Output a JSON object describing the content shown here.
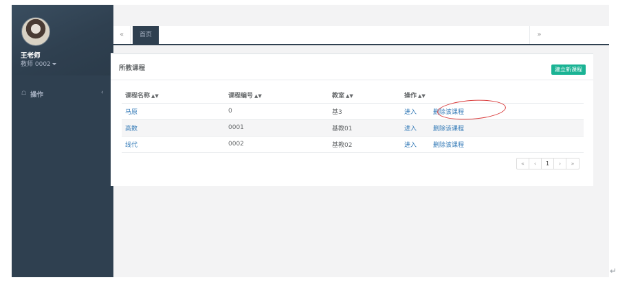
{
  "sidebar": {
    "user_name": "王老师",
    "user_role": "教师 0002",
    "nav_items": [
      {
        "icon": "home-icon",
        "label": "操作",
        "arrow": "‹"
      }
    ]
  },
  "tabs": {
    "prev": "«",
    "active": "首页",
    "next": "»"
  },
  "panel": {
    "title": "所教课程",
    "new_button": "建立新课程",
    "columns": [
      "课程名称",
      "课程编号",
      "教室",
      "操作"
    ],
    "rows": [
      {
        "name": "马原",
        "code": "0",
        "room": "基3",
        "enter": "进入",
        "delete": "删除该课程"
      },
      {
        "name": "高数",
        "code": "0001",
        "room": "基教01",
        "enter": "进入",
        "delete": "删除该课程"
      },
      {
        "name": "线代",
        "code": "0002",
        "room": "基教02",
        "enter": "进入",
        "delete": "删除该课程"
      }
    ],
    "pagination": {
      "first": "«",
      "prev": "‹",
      "current": "1",
      "next": "›",
      "last": "»"
    }
  },
  "colors": {
    "sidebar": "#2f4050",
    "accent": "#1ab394",
    "link": "#337ab7",
    "annotation": "#d93a3a"
  }
}
